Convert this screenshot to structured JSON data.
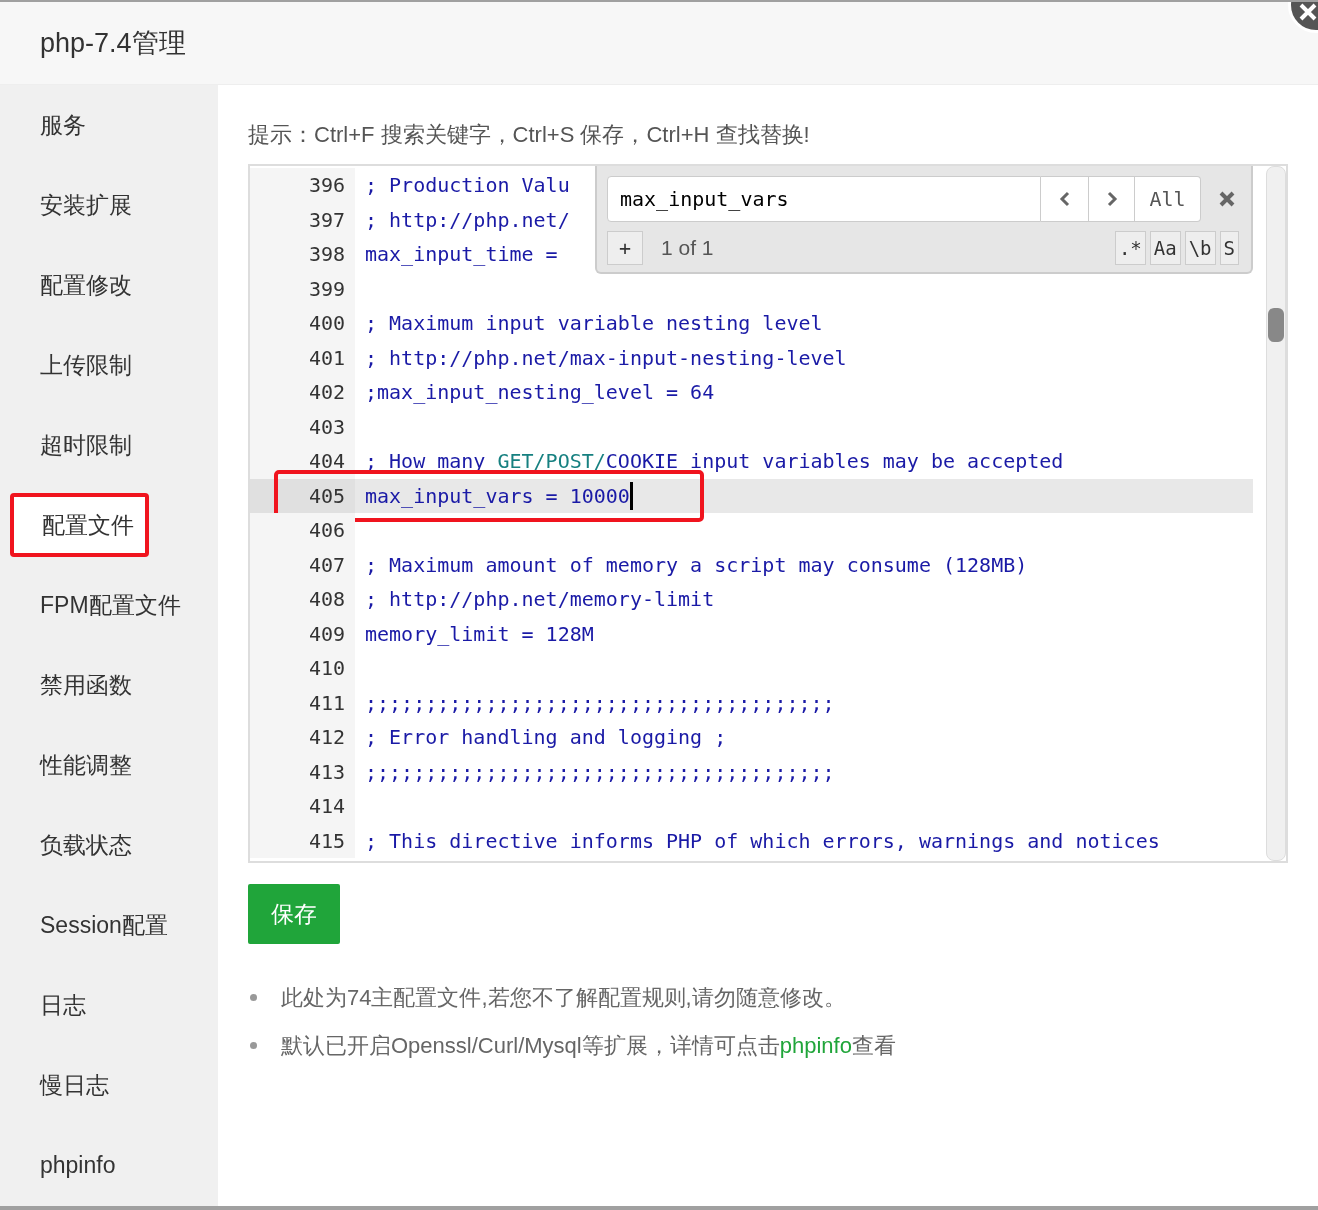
{
  "window": {
    "title": "php-7.4管理"
  },
  "sidebar": {
    "items": [
      {
        "label": "服务",
        "selected": false,
        "annotated": false
      },
      {
        "label": "安装扩展",
        "selected": false,
        "annotated": false
      },
      {
        "label": "配置修改",
        "selected": false,
        "annotated": false
      },
      {
        "label": "上传限制",
        "selected": false,
        "annotated": false
      },
      {
        "label": "超时限制",
        "selected": false,
        "annotated": false
      },
      {
        "label": "配置文件",
        "selected": true,
        "annotated": true
      },
      {
        "label": "FPM配置文件",
        "selected": false,
        "annotated": false
      },
      {
        "label": "禁用函数",
        "selected": false,
        "annotated": false
      },
      {
        "label": "性能调整",
        "selected": false,
        "annotated": false
      },
      {
        "label": "负载状态",
        "selected": false,
        "annotated": false
      },
      {
        "label": "Session配置",
        "selected": false,
        "annotated": false
      },
      {
        "label": "日志",
        "selected": false,
        "annotated": false
      },
      {
        "label": "慢日志",
        "selected": false,
        "annotated": false
      },
      {
        "label": "phpinfo",
        "selected": false,
        "annotated": false
      }
    ]
  },
  "hint": "提示：Ctrl+F 搜索关键字，Ctrl+S 保存，Ctrl+H 查找替换!",
  "editor": {
    "lines": [
      {
        "number": "396",
        "active": false,
        "annotated": false,
        "parts": [
          {
            "text": "; Production Valu",
            "kind": "comment"
          }
        ]
      },
      {
        "number": "397",
        "active": false,
        "annotated": false,
        "parts": [
          {
            "text": "; http://php.net/",
            "kind": "comment"
          }
        ]
      },
      {
        "number": "398",
        "active": false,
        "annotated": false,
        "parts": [
          {
            "text": "max_input_time = ",
            "kind": "code"
          }
        ]
      },
      {
        "number": "399",
        "active": false,
        "annotated": false
      },
      {
        "number": "400",
        "active": false,
        "annotated": false,
        "parts": [
          {
            "text": "; Maximum input variable nesting level",
            "kind": "comment"
          }
        ]
      },
      {
        "number": "401",
        "active": false,
        "annotated": false,
        "parts": [
          {
            "text": "; http://php.net/max-input-nesting-level",
            "kind": "comment"
          }
        ]
      },
      {
        "number": "402",
        "active": false,
        "annotated": false,
        "parts": [
          {
            "text": ";max_input_nesting_level = 64",
            "kind": "comment"
          }
        ]
      },
      {
        "number": "403",
        "active": false,
        "annotated": false
      },
      {
        "number": "404",
        "active": false,
        "annotated": false,
        "parts": [
          {
            "text": "; How many ",
            "kind": "comment"
          },
          {
            "text": "GET/POST/",
            "kind": "keyword"
          },
          {
            "text": "COOKIE input variables may be accepted",
            "kind": "comment"
          }
        ]
      },
      {
        "number": "405",
        "active": true,
        "annotated": true,
        "parts": [
          {
            "text": "max_input_vars = 10000",
            "kind": "code"
          }
        ]
      },
      {
        "number": "406",
        "active": false,
        "annotated": false
      },
      {
        "number": "407",
        "active": false,
        "annotated": false,
        "parts": [
          {
            "text": "; Maximum amount of memory a script may consume (128MB)",
            "kind": "comment"
          }
        ]
      },
      {
        "number": "408",
        "active": false,
        "annotated": false,
        "parts": [
          {
            "text": "; http://php.net/memory-limit",
            "kind": "comment"
          }
        ]
      },
      {
        "number": "409",
        "active": false,
        "annotated": false,
        "parts": [
          {
            "text": "memory_limit = 128M",
            "kind": "code"
          }
        ]
      },
      {
        "number": "410",
        "active": false,
        "annotated": false
      },
      {
        "number": "411",
        "active": false,
        "annotated": false,
        "parts": [
          {
            "text": ";;;;;;;;;;;;;;;;;;;;;;;;;;;;;;;;;;;;;;;",
            "kind": "comment"
          }
        ]
      },
      {
        "number": "412",
        "active": false,
        "annotated": false,
        "parts": [
          {
            "text": "; Error handling and logging ;",
            "kind": "comment"
          }
        ]
      },
      {
        "number": "413",
        "active": false,
        "annotated": false,
        "parts": [
          {
            "text": ";;;;;;;;;;;;;;;;;;;;;;;;;;;;;;;;;;;;;;;",
            "kind": "comment"
          }
        ]
      },
      {
        "number": "414",
        "active": false,
        "annotated": false
      },
      {
        "number": "415",
        "active": false,
        "annotated": false,
        "parts": [
          {
            "text": "; This directive informs PHP of which errors, warnings and notices",
            "kind": "comment"
          }
        ]
      }
    ],
    "search": {
      "query": "max_input_vars",
      "all_label": "All",
      "add_label": "+",
      "count": "1 of 1",
      "toggles": [
        ".*",
        "Aa",
        "\\b",
        "S"
      ]
    }
  },
  "save_button": "保存",
  "notes": [
    {
      "text": "此处为74主配置文件,若您不了解配置规则,请勿随意修改。"
    },
    {
      "text": "默认已开启Openssl/Curl/Mysql等扩展，详情可点击",
      "link": "phpinfo",
      "after": "查看"
    }
  ]
}
